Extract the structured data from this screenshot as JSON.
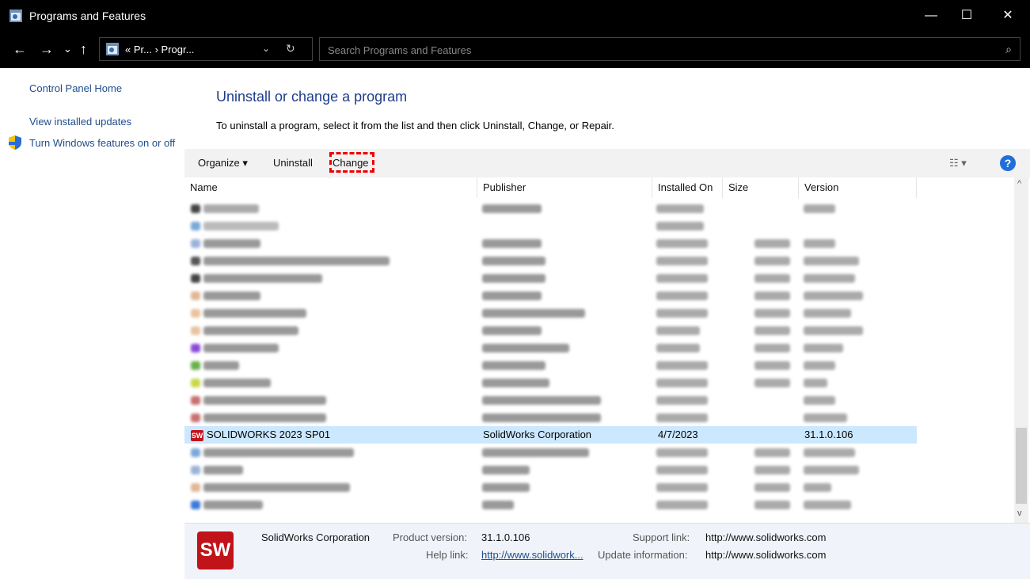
{
  "window": {
    "title": "Programs and Features",
    "minimize": "—",
    "maximize": "☐",
    "close": "✕"
  },
  "nav": {
    "back": "←",
    "forward": "→",
    "recent": "⌄",
    "up": "↑",
    "breadcrumb": "« Pr... › Progr...",
    "dropdown": "⌄",
    "refresh": "↻",
    "search_placeholder": "Search Programs and Features",
    "search_icon": "⌕"
  },
  "sidebar": {
    "items": [
      {
        "label": "Control Panel Home"
      },
      {
        "label": "View installed updates"
      },
      {
        "label": "Turn Windows features on or off"
      }
    ]
  },
  "main": {
    "heading": "Uninstall or change a program",
    "instruction": "To uninstall a program, select it from the list and then click Uninstall, Change, or Repair."
  },
  "toolbar": {
    "organize": "Organize ▾",
    "uninstall": "Uninstall",
    "change": "Change",
    "view": "☷ ▾",
    "help": "?"
  },
  "columns": [
    "Name",
    "Publisher",
    "Installed On",
    "Size",
    "Version"
  ],
  "selected_program": {
    "icon_text": "SW",
    "name": "SOLIDWORKS 2023 SP01",
    "publisher": "SolidWorks Corporation",
    "installed_on": "4/7/2023",
    "size": "",
    "version": "31.1.0.106"
  },
  "details": {
    "logo_text": "SW",
    "publisher": "SolidWorks Corporation",
    "product_version_label": "Product version:",
    "product_version": "31.1.0.106",
    "help_link_label": "Help link:",
    "help_link": "http://www.solidwork...",
    "support_link_label": "Support link:",
    "support_link": "http://www.solidworks.com",
    "update_info_label": "Update information:",
    "update_info": "http://www.solidworks.com"
  },
  "colors": {
    "selection": "#cce8ff",
    "accent": "#1e4e8c",
    "highlight_box": "#e00000"
  }
}
